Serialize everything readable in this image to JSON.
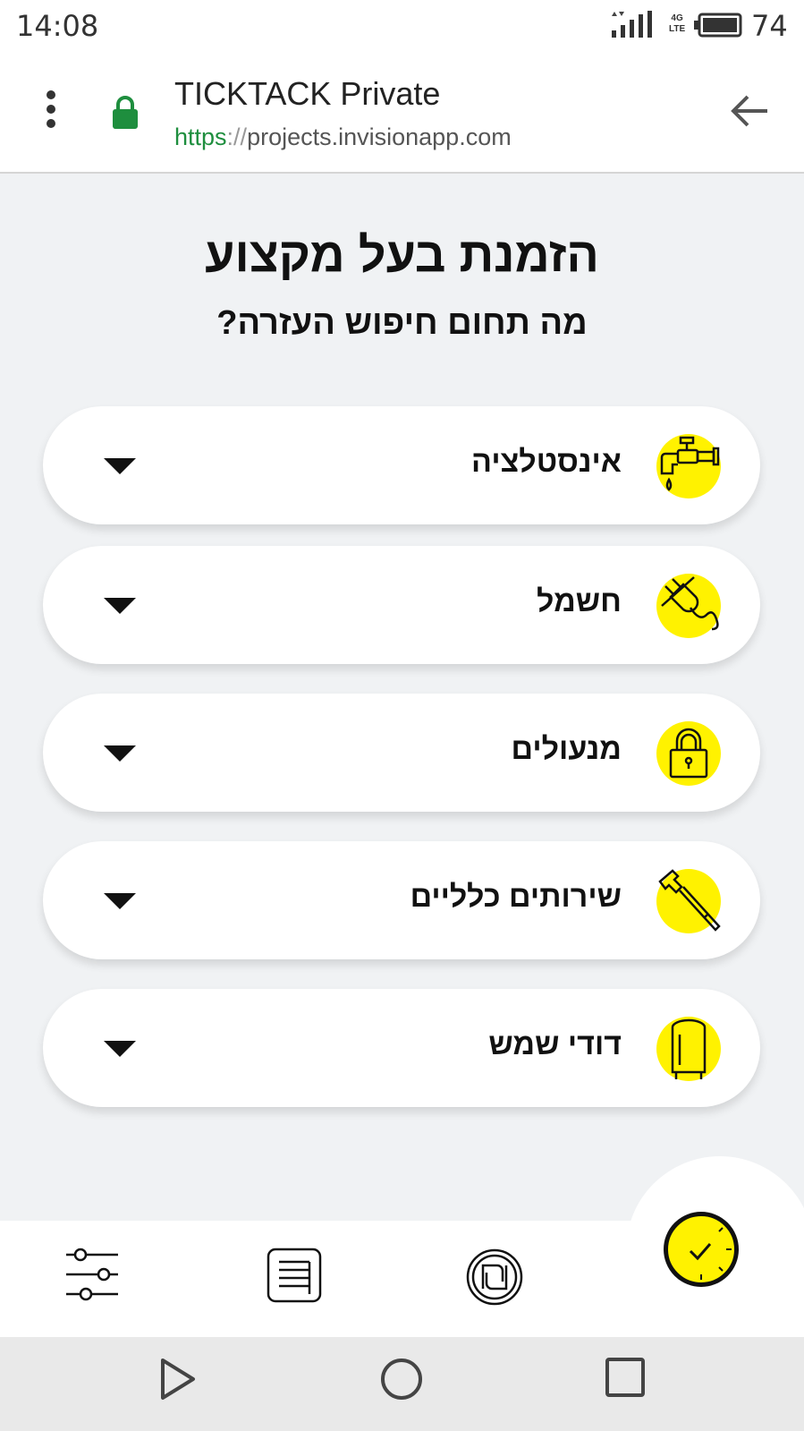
{
  "status_bar": {
    "time": "14:08",
    "network": "4G",
    "network_sub": "LTE",
    "battery": "74"
  },
  "browser": {
    "title": "TICKTACK Private",
    "url_scheme": "https",
    "url_sep": "://",
    "url_host": "projects.invisionapp.com"
  },
  "page": {
    "title": "הזמנת בעל מקצוע",
    "subtitle": "מה תחום חיפוש העזרה?"
  },
  "categories": [
    {
      "label": "אינסטלציה",
      "icon": "faucet-icon"
    },
    {
      "label": "חשמל",
      "icon": "plug-icon"
    },
    {
      "label": "מנעולים",
      "icon": "padlock-icon"
    },
    {
      "label": "שירותים כלליים",
      "icon": "hammer-icon"
    },
    {
      "label": "דודי שמש",
      "icon": "water-heater-icon"
    }
  ],
  "bottom_nav": {
    "items": [
      "filters-icon",
      "list-icon",
      "shekel-icon",
      "clock-icon"
    ]
  },
  "colors": {
    "accent": "#fff200",
    "background": "#f0f2f4",
    "url_green": "#1e8e3e"
  }
}
